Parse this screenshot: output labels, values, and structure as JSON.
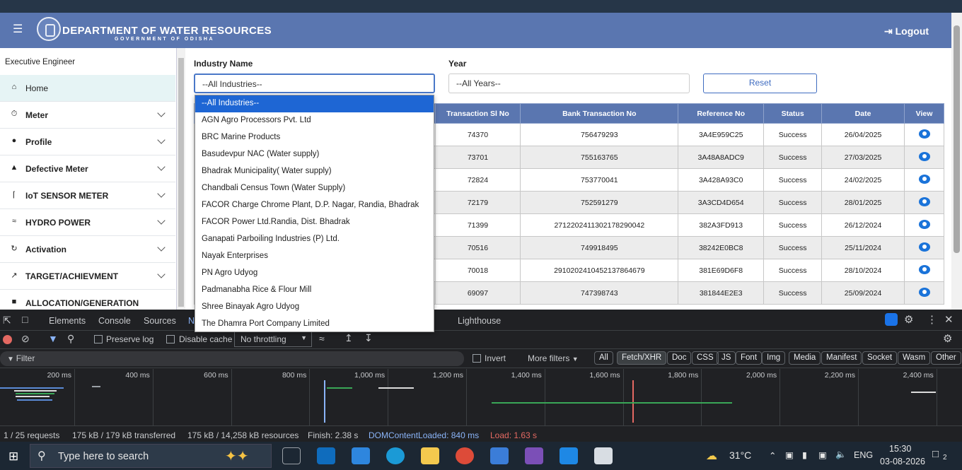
{
  "header": {
    "title": "DEPARTMENT OF WATER RESOURCES",
    "subtitle": "GOVERNMENT OF ODISHA",
    "logout": "Logout"
  },
  "sidebar": {
    "role": "Executive Engineer",
    "items": [
      {
        "label": "Home",
        "icon": "home-icon"
      },
      {
        "label": "Meter",
        "icon": "meter-icon"
      },
      {
        "label": "Profile",
        "icon": "person-icon"
      },
      {
        "label": "Defective Meter",
        "icon": "warning-icon"
      },
      {
        "label": "IoT SENSOR METER",
        "icon": "sensor-icon"
      },
      {
        "label": "HYDRO POWER",
        "icon": "wave-icon"
      },
      {
        "label": "Activation",
        "icon": "activation-icon"
      },
      {
        "label": "TARGET/ACHIEVMENT",
        "icon": "trend-icon"
      },
      {
        "label": "ALLOCATION/GENERATION",
        "icon": "document-icon"
      }
    ]
  },
  "filters": {
    "industry_label": "Industry Name",
    "industry_value": "--All Industries--",
    "year_label": "Year",
    "year_value": "--All Years--",
    "reset": "Reset"
  },
  "table": {
    "headers": [
      "Transaction Sl No",
      "Bank Transaction No",
      "Reference No",
      "Status",
      "Date",
      "View"
    ],
    "rows": [
      [
        "74370",
        "756479293",
        "3A4E959C25",
        "Success",
        "26/04/2025"
      ],
      [
        "73701",
        "755163765",
        "3A48A8ADC9",
        "Success",
        "27/03/2025"
      ],
      [
        "72824",
        "753770041",
        "3A428A93C0",
        "Success",
        "24/02/2025"
      ],
      [
        "72179",
        "752591279",
        "3A3CD4D654",
        "Success",
        "28/01/2025"
      ],
      [
        "71399",
        "27122024113021782900​42",
        "382A3FD913",
        "Success",
        "26/12/2024"
      ],
      [
        "70516",
        "749918495",
        "38242E0BC8",
        "Success",
        "25/11/2024"
      ],
      [
        "70018",
        "291020241045213786​4679",
        "381E69D6F8",
        "Success",
        "28/10/2024"
      ],
      [
        "69097",
        "747398743",
        "381844E2E3",
        "Success",
        "25/09/2024"
      ]
    ]
  },
  "dropdown": {
    "options": [
      "--All Industries--",
      "AGN Agro Processors Pvt. Ltd",
      "BRC Marine Products",
      "Basudevpur NAC (Water supply)",
      "Bhadrak Municipality( Water supply)",
      "Chandbali Census Town (Water Supply)",
      "FACOR Charge Chrome Plant, D.P. Nagar, Randia, Bhadrak",
      "FACOR Power Ltd.Randia, Dist. Bhadrak",
      "Ganapati Parboiling Industries (P) Ltd.",
      "Nayak Enterprises",
      "PN Agro Udyog",
      "Padmanabha Rice & Flour Mill",
      "Shree Binayak Agro Udyog",
      "The Dhamra Port Company Limited"
    ]
  },
  "devtools": {
    "tabs": [
      "Elements",
      "Console",
      "Sources",
      "N",
      "Lighthouse"
    ],
    "preserve_log": "Preserve log",
    "disable_cache": "Disable cache",
    "throttling": "No throttling",
    "filter_placeholder": "Filter",
    "invert": "Invert",
    "more_filters": "More filters",
    "type_filters": [
      "All",
      "Fetch/XHR",
      "Doc",
      "CSS",
      "JS",
      "Font",
      "Img",
      "Media",
      "Manifest",
      "Socket",
      "Wasm",
      "Other"
    ],
    "ticks": [
      "200 ms",
      "400 ms",
      "600 ms",
      "800 ms",
      "1,000 ms",
      "1,200 ms",
      "1,400 ms",
      "1,600 ms",
      "1,800 ms",
      "2,000 ms",
      "2,200 ms",
      "2,400 ms"
    ],
    "status": {
      "requests": "1 / 25 requests",
      "transferred": "175 kB / 179 kB transferred",
      "resources": "175 kB / 14,258 kB resources",
      "finish": "Finish: 2.38 s",
      "dcl": "DOMContentLoaded: 840 ms",
      "load": "Load: 1.63 s"
    }
  },
  "taskbar": {
    "search": "Type here to search",
    "temp": "31°C",
    "lang": "ENG",
    "time": "15:30",
    "date": "03-08-2026",
    "notif": "2"
  }
}
